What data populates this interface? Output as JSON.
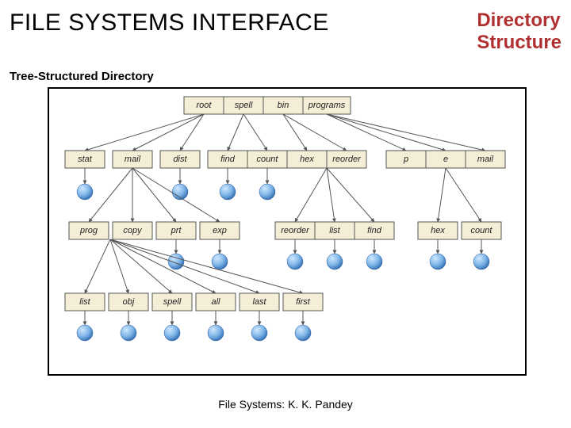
{
  "header": {
    "title": "FILE SYSTEMS INTERFACE",
    "subtitle_line1": "Directory",
    "subtitle_line2": "Structure"
  },
  "section_label": "Tree-Structured Directory",
  "footer": "File Systems: K. K. Pandey",
  "diagram": {
    "type": "tree",
    "root_row": [
      "root",
      "spell",
      "bin",
      "programs"
    ],
    "row2": [
      "stat",
      "mail",
      "dist",
      "find",
      "count",
      "hex",
      "reorder",
      "p",
      "e",
      "mail"
    ],
    "row3_left": [
      "prog",
      "copy",
      "prt",
      "exp"
    ],
    "row3_mid": [
      "reorder",
      "list",
      "find"
    ],
    "row3_right": [
      "hex",
      "count"
    ],
    "row4": [
      "list",
      "obj",
      "spell",
      "all",
      "last",
      "first"
    ],
    "edges_description": "root→stat,mail,dist; spell→find,count; bin→hex,reorder; programs→p,e,mail; mail→prog,copy,prt,exp; hex/reorder→reorder,list,find; p/e/mail→hex,count; prog/copy→list,obj,spell,all,last,first; leaf circles under stat,dist,find,count,prt,exp, row3_mid entries, row3_right entries, and all row4 entries"
  }
}
